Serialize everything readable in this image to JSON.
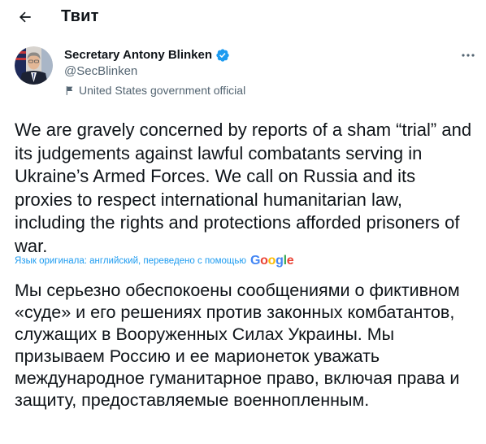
{
  "header": {
    "title": "Твит",
    "back_icon": "arrow-left-icon"
  },
  "author": {
    "name": "Secretary Antony Blinken",
    "handle": "@SecBlinken",
    "verified_icon": "verified-badge-icon",
    "official_label": "United States government official",
    "official_icon": "flag-icon"
  },
  "more_icon": "more-options-icon",
  "tweet": {
    "text": "We are gravely concerned by reports of a sham “trial” and its judgements against lawful combatants serving in Ukraine’s Armed Forces. We call on Russia and its proxies to respect international humanitarian law, including the rights and protections afforded prisoners of war."
  },
  "translation": {
    "note": "Язык оригинала: английский, переведено с помощью",
    "provider": "Google",
    "text": "Мы серьезно обеспокоены сообщениями о фиктивном «суде» и его решениях против законных комбатантов, служащих в Вооруженных Силах Украины. Мы призываем Россию и ее марионеток уважать международное гуманитарное право, включая права и защиту, предоставляемые военнопленным."
  },
  "colors": {
    "accent": "#1d9bf0",
    "text": "#0f1419",
    "secondary": "#536471",
    "background": "#ffffff"
  }
}
